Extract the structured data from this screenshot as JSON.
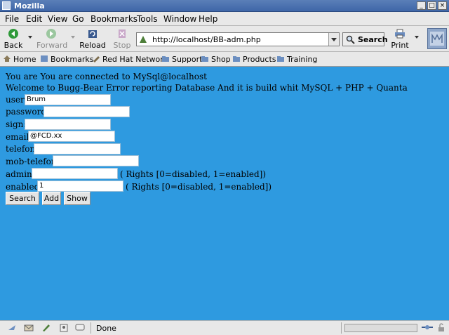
{
  "window": {
    "title": "Mozilla"
  },
  "menu": [
    "File",
    "Edit",
    "View",
    "Go",
    "Bookmarks",
    "Tools",
    "Window",
    "Help"
  ],
  "nav": {
    "back": "Back",
    "forward": "Forward",
    "reload": "Reload",
    "stop": "Stop",
    "url": "http://localhost/BB-adm.php",
    "search": "Search",
    "print": "Print"
  },
  "personal": [
    "Home",
    "Bookmarks",
    "Red Hat Network",
    "Support",
    "Shop",
    "Products",
    "Training"
  ],
  "page": {
    "line1": "You are You are connected to MySql@localhost",
    "line2": "Welcome to Bugg-Bear Error reporting Database And it is build whit MySQL + PHP + Quanta",
    "fields": {
      "user": {
        "label": "user:",
        "value": "Brum"
      },
      "password": {
        "label": "password:",
        "value": ""
      },
      "sign": {
        "label": "sign:",
        "value": ""
      },
      "email": {
        "label": "email:",
        "value": "@FCD.xx"
      },
      "telefon": {
        "label": "telefon:",
        "value": ""
      },
      "mob_telefon": {
        "label": "mob-telefon:",
        "value": ""
      },
      "admin": {
        "label": "admin:",
        "value": "",
        "hint": "( Rights [0=disabled, 1=enabled])"
      },
      "enabled": {
        "label": "enabled:",
        "value": "1",
        "hint": "( Rights [0=disabled, 1=enabled])"
      }
    },
    "buttons": {
      "search": "Search",
      "add": "Add",
      "show": "Show"
    }
  },
  "status": {
    "text": "Done"
  },
  "colors": {
    "content_bg": "#2e9ae0",
    "titlebar": "#4a72b0"
  }
}
